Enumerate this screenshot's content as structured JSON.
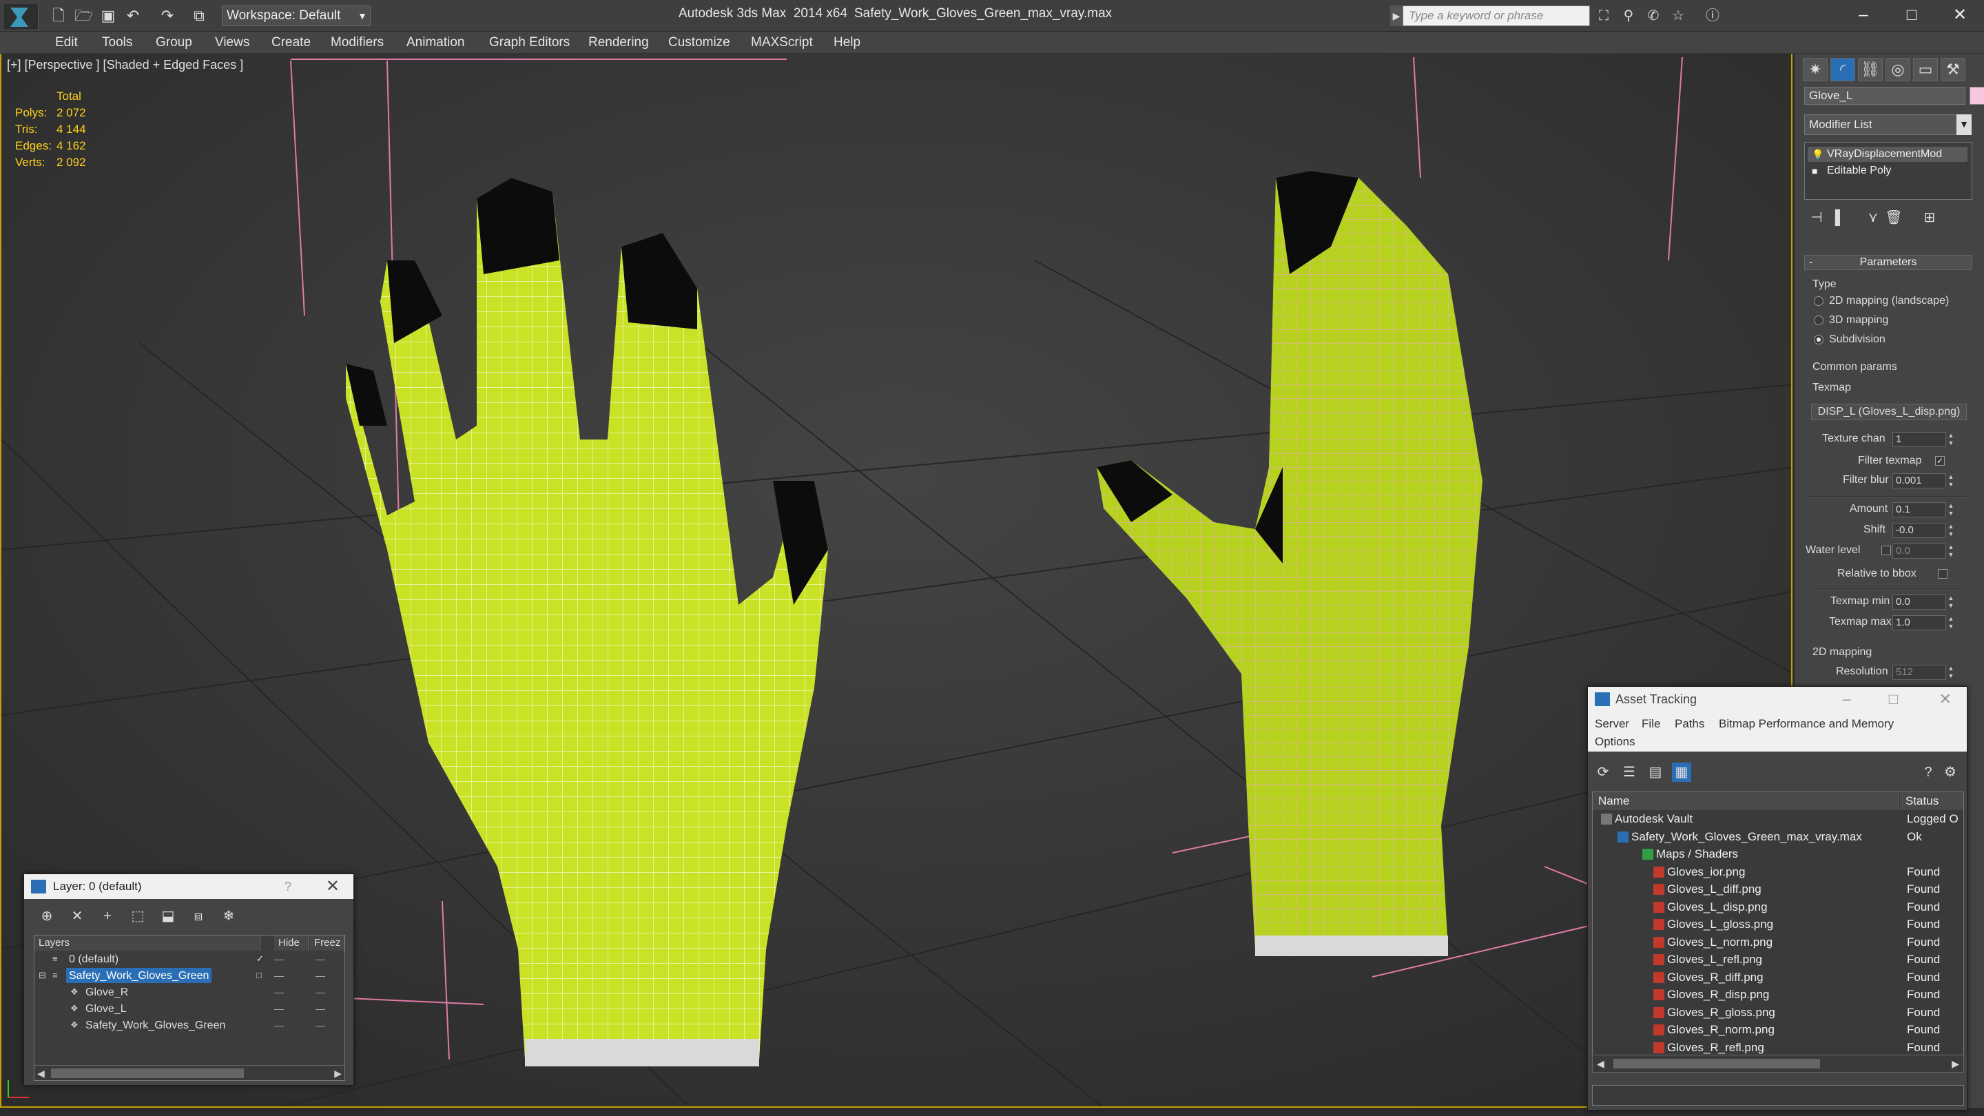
{
  "titlebar": {
    "workspace": "Workspace: Default",
    "app_title": "Autodesk 3ds Max  2014 x64",
    "file_title": "Safety_Work_Gloves_Green_max_vray.max",
    "search_placeholder": "Type a keyword or phrase"
  },
  "menu": [
    "Edit",
    "Tools",
    "Group",
    "Views",
    "Create",
    "Modifiers",
    "Animation",
    "Graph Editors",
    "Rendering",
    "Customize",
    "MAXScript",
    "Help"
  ],
  "viewport": {
    "label": "[+] [Perspective ] [Shaded + Edged Faces ]",
    "stats": {
      "header": "Total",
      "rows": [
        {
          "k": "Polys:",
          "v": "2 072"
        },
        {
          "k": "Tris:",
          "v": "4 144"
        },
        {
          "k": "Edges:",
          "v": "4 162"
        },
        {
          "k": "Verts:",
          "v": "2 092"
        }
      ]
    }
  },
  "command_panel": {
    "object_name": "Glove_L",
    "object_color": "#f7c6e3",
    "modifier_list": "Modifier List",
    "stack": [
      "VRayDisplacementMod",
      "Editable Poly"
    ],
    "rollout_title": "Parameters",
    "type_group": "Type",
    "type_options": [
      "2D mapping (landscape)",
      "3D mapping",
      "Subdivision"
    ],
    "type_selected": "Subdivision",
    "common_group": "Common params",
    "texmap_label": "Texmap",
    "texmap_value": "DISP_L (Gloves_L_disp.png)",
    "texture_chan_label": "Texture chan",
    "texture_chan": "1",
    "filter_texmap_label": "Filter texmap",
    "filter_blur_label": "Filter blur",
    "filter_blur": "0.001",
    "amount_label": "Amount",
    "amount": "0.1",
    "shift_label": "Shift",
    "shift": "-0.0",
    "water_level_label": "Water level",
    "water_level": "0.0",
    "relative_bbox_label": "Relative to bbox",
    "texmap_min_label": "Texmap min",
    "texmap_min": "0.0",
    "texmap_max_label": "Texmap max",
    "texmap_max": "1.0",
    "mapping2d_group": "2D mapping",
    "resolution_label": "Resolution",
    "resolution": "512"
  },
  "layer_window": {
    "title": "Layer: 0 (default)",
    "help": "?",
    "col_layers": "Layers",
    "col_hide": "Hide",
    "col_freeze": "Freez",
    "rows": [
      {
        "name": "0 (default)",
        "checked": true
      },
      {
        "name": "Safety_Work_Gloves_Green",
        "selected": true
      },
      {
        "name": "Glove_R"
      },
      {
        "name": "Glove_L"
      },
      {
        "name": "Safety_Work_Gloves_Green"
      }
    ]
  },
  "asset_window": {
    "title": "Asset Tracking",
    "menu": [
      "Server",
      "File",
      "Paths",
      "Bitmap Performance and Memory",
      "Options"
    ],
    "col_name": "Name",
    "col_status": "Status",
    "rows": [
      {
        "name": "Autodesk Vault",
        "status": "Logged O"
      },
      {
        "name": "Safety_Work_Gloves_Green_max_vray.max",
        "status": "Ok"
      },
      {
        "name": "Maps / Shaders",
        "status": ""
      },
      {
        "name": "Gloves_ior.png",
        "status": "Found"
      },
      {
        "name": "Gloves_L_diff.png",
        "status": "Found"
      },
      {
        "name": "Gloves_L_disp.png",
        "status": "Found"
      },
      {
        "name": "Gloves_L_gloss.png",
        "status": "Found"
      },
      {
        "name": "Gloves_L_norm.png",
        "status": "Found"
      },
      {
        "name": "Gloves_L_refl.png",
        "status": "Found"
      },
      {
        "name": "Gloves_R_diff.png",
        "status": "Found"
      },
      {
        "name": "Gloves_R_disp.png",
        "status": "Found"
      },
      {
        "name": "Gloves_R_gloss.png",
        "status": "Found"
      },
      {
        "name": "Gloves_R_norm.png",
        "status": "Found"
      },
      {
        "name": "Gloves_R_refl.png",
        "status": "Found"
      }
    ]
  }
}
